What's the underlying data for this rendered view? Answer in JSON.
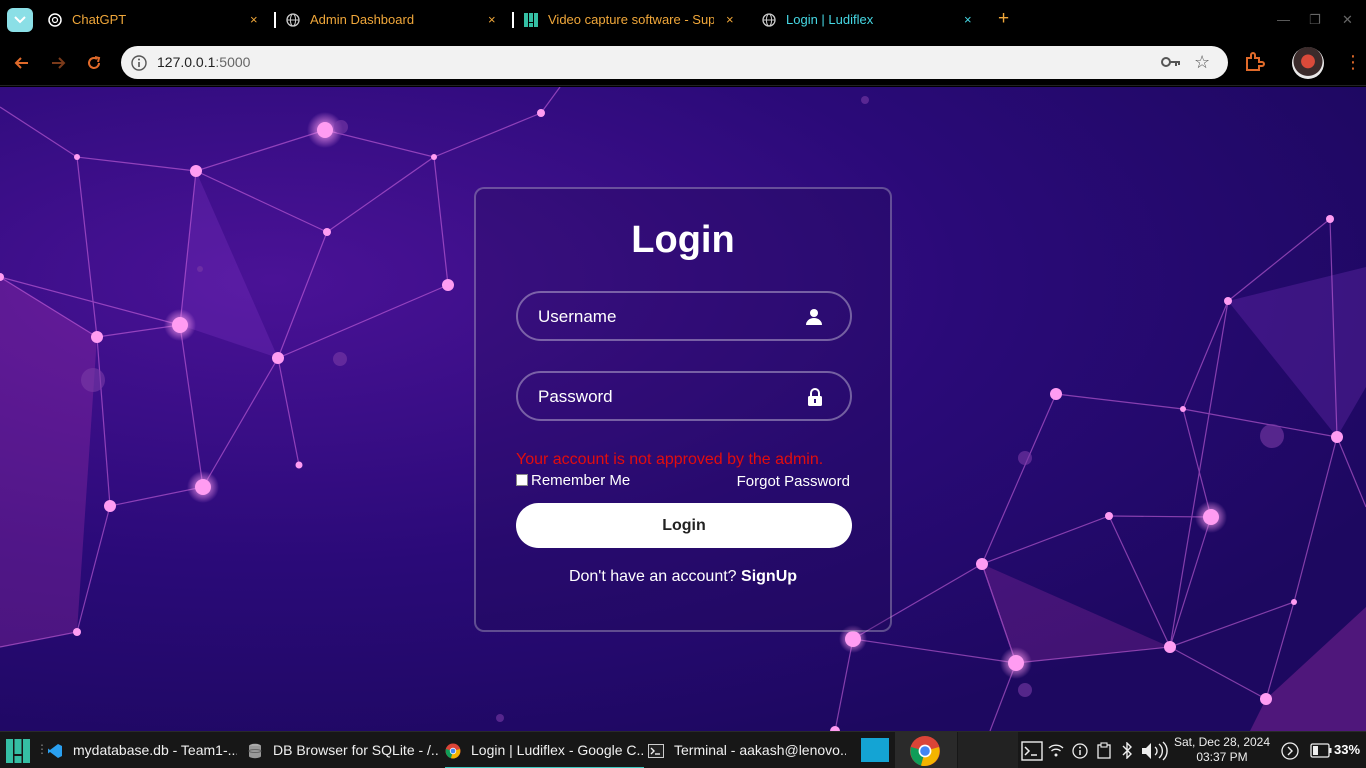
{
  "browser": {
    "tabs": [
      {
        "title": "ChatGPT",
        "active": false
      },
      {
        "title": "Admin Dashboard",
        "active": false
      },
      {
        "title": "Video capture software - Sup",
        "active": false
      },
      {
        "title": "Login | Ludiflex",
        "active": true
      }
    ],
    "close_glyph": "×",
    "new_tab_glyph": "+",
    "window_controls": {
      "minimize": "—",
      "restore": "❐",
      "close": "✕"
    },
    "url_host": "127.0.0.1",
    "url_port": ":5000",
    "menu_glyph": "⋮",
    "star_glyph": "☆"
  },
  "login": {
    "title": "Login",
    "username_placeholder": "Username",
    "password_placeholder": "Password",
    "error_message": "Your account is not approved by the admin.",
    "remember_label": "Remember Me",
    "forgot_label": "Forgot Password",
    "button_label": "Login",
    "signup_prompt": "Don't have an account?",
    "signup_link": "SignUp"
  },
  "taskbar": {
    "apps": [
      {
        "label": "mydatabase.db - Team1-..."
      },
      {
        "label": "DB Browser for SQLite - /..."
      },
      {
        "label": "Login | Ludiflex - Google C..."
      },
      {
        "label": "Terminal - aakash@lenovo..."
      }
    ],
    "clock_date": "Sat, Dec 28, 2024",
    "clock_time": "03:37 PM",
    "battery": "33%"
  },
  "colors": {
    "accent_tab": "#46d8e4",
    "tab_text": "#f0a73a",
    "error": "#e30d0d",
    "bg_purple": "#2a0a78"
  }
}
